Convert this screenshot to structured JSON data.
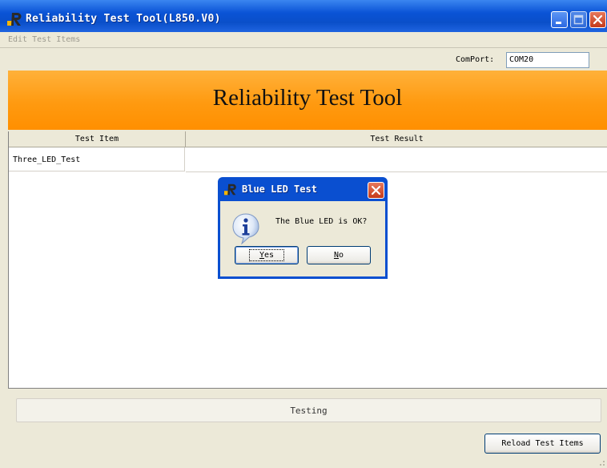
{
  "window": {
    "title": "Reliability Test Tool(L850.V0)",
    "app_icon": "app-r-icon"
  },
  "menu": {
    "edit_test_items": "Edit Test Items"
  },
  "comport": {
    "label": "ComPort:",
    "value": "COM20"
  },
  "banner": {
    "title": "Reliability Test Tool",
    "color": "#ff9a10"
  },
  "table": {
    "headers": [
      "Test Item",
      "Test Result"
    ],
    "rows": [
      {
        "item": "Three_LED_Test",
        "result": ""
      }
    ]
  },
  "status": {
    "text": "Testing"
  },
  "buttons": {
    "reload": "Reload Test Items"
  },
  "dialog": {
    "title": "Blue LED Test",
    "message": "The Blue LED is OK?",
    "yes_first": "Y",
    "yes_rest": "es",
    "no_first": "N",
    "no_rest": "o",
    "icon": "info-icon"
  },
  "colors": {
    "titlebar": "#0a53d6",
    "close_button": "#c43a1a",
    "background": "#ece9d8"
  }
}
